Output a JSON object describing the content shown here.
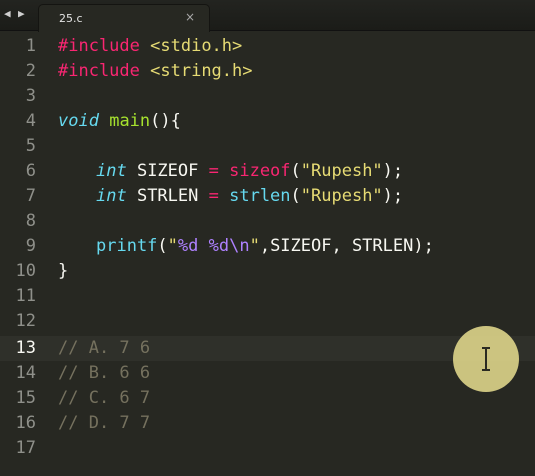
{
  "tab": {
    "label": "25.c",
    "close_glyph": "×"
  },
  "nav": {
    "back_glyph": "◀",
    "forward_glyph": "▶"
  },
  "editor": {
    "line_numbers": [
      "1",
      "2",
      "3",
      "4",
      "5",
      "6",
      "7",
      "8",
      "9",
      "10",
      "11",
      "12",
      "13",
      "14",
      "15",
      "16",
      "17"
    ],
    "active_line": "13",
    "code": {
      "l1": {
        "directive": "#include",
        "header": "<stdio.h>"
      },
      "l2": {
        "directive": "#include",
        "header": "<string.h>"
      },
      "l4": {
        "type": "void",
        "func": "main",
        "rest": "(){"
      },
      "l6": {
        "type": "int",
        "var": " SIZEOF ",
        "eq": "=",
        "call": "sizeof",
        "open": "(",
        "str": "\"Rupesh\"",
        "close": ");"
      },
      "l7": {
        "type": "int",
        "var": " STRLEN ",
        "eq": "=",
        "call": "strlen",
        "open": "(",
        "str": "\"Rupesh\"",
        "close": ");"
      },
      "l9": {
        "call": "printf",
        "open": "(",
        "q1": "\"",
        "fmt": "%d %d\\n",
        "q2": "\"",
        "rest": ",SIZEOF, STRLEN);"
      },
      "l10": {
        "text": "}"
      },
      "l13": {
        "comment": "// A. 7 6"
      },
      "l14": {
        "comment": "// B. 6 6"
      },
      "l15": {
        "comment": "// C. 6 7"
      },
      "l16": {
        "comment": "// D. 7 7"
      }
    }
  },
  "cursor": {
    "icon": "text-cursor-icon"
  },
  "colors": {
    "background": "#272822",
    "keyword": "#f92672",
    "string": "#e6db74",
    "type": "#66d9ef",
    "function": "#a6e22e",
    "format": "#ae81ff",
    "comment": "#75715e"
  }
}
